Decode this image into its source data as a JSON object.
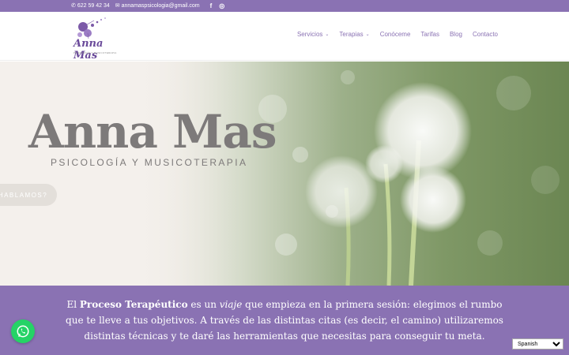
{
  "topbar": {
    "phone": "622 59 42 34",
    "email": "annamaspsicologia@gmail.com",
    "social": [
      {
        "icon": "facebook-icon",
        "glyph": "f"
      },
      {
        "icon": "instagram-icon",
        "glyph": "◎"
      }
    ]
  },
  "logo": {
    "name": "Anna Mas",
    "tagline": "PSICOLOGÍA Y MUSICOTERAPIA"
  },
  "nav": {
    "items": [
      {
        "label": "Servicios",
        "has_dropdown": true
      },
      {
        "label": "Terapias",
        "has_dropdown": true
      },
      {
        "label": "Conóceme"
      },
      {
        "label": "Tarifas"
      },
      {
        "label": "Blog"
      },
      {
        "label": "Contacto"
      }
    ]
  },
  "hero": {
    "title": "Anna Mas",
    "subtitle": "PSICOLOGÍA Y MUSICOTERAPIA",
    "button_label": "HABLAMOS?"
  },
  "band": {
    "p1_pre": "El ",
    "p1_bold": "Proceso Terapéutico",
    "p1_mid": " es un ",
    "p1_italic": "viaje",
    "p1_post": " que empieza en la primera sesión: elegimos el rumbo que te lleve a tus objetivos. A través de las distintas citas (es decir, el camino) utilizaremos distintas técnicas y te daré las herramientas que necesitas para conseguir tu meta."
  },
  "language": {
    "selected": "Spanish"
  },
  "colors": {
    "brand_purple": "#8a72b3",
    "whatsapp_green": "#25d366"
  }
}
